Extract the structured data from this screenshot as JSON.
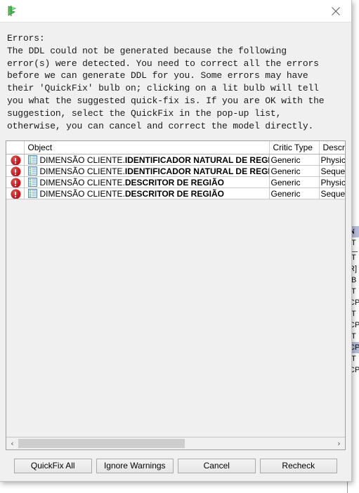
{
  "window": {
    "title": "",
    "app_icon": "green-flag-icon",
    "close_label": "✕"
  },
  "message": {
    "heading": "Errors:",
    "body": "The DDL could not be generated because the following\nerror(s) were detected. You need to correct all the errors\nbefore we can generate DDL for you. Some errors may have\ntheir 'QuickFix' bulb on; clicking on a lit bulb will tell\nyou what the suggested quick-fix is. If you are OK with the\nsuggestion, select the QuickFix in the pop-up list,\notherwise, you can cancel and correct the model directly."
  },
  "table": {
    "columns": [
      "",
      "Object",
      "Critic Type",
      "Descript"
    ],
    "rows": [
      {
        "severity_icon": "error-icon",
        "object_icon": "table-grid-icon",
        "object_prefix": "DIMENSÃO CLIENTE.",
        "object_name": "IDENTIFICADOR NATURAL DE REGIÃO",
        "critic_type": "Generic",
        "description": "Physical n"
      },
      {
        "severity_icon": "error-icon",
        "object_icon": "table-grid-icon",
        "object_prefix": "DIMENSÃO CLIENTE.",
        "object_name": "IDENTIFICADOR NATURAL DE REGIÃO",
        "critic_type": "Generic",
        "description": "Sequence"
      },
      {
        "severity_icon": "error-icon",
        "object_icon": "table-grid-icon",
        "object_prefix": "DIMENSÃO CLIENTE.",
        "object_name": "DESCRITOR DE REGIÃO",
        "critic_type": "Generic",
        "description": "Physical n"
      },
      {
        "severity_icon": "error-icon",
        "object_icon": "table-grid-icon",
        "object_prefix": "DIMENSÃO CLIENTE.",
        "object_name": "DESCRITOR DE REGIÃO",
        "critic_type": "Generic",
        "description": "Sequence"
      }
    ]
  },
  "scrollbar": {
    "left_arrow": "‹",
    "right_arrow": "›",
    "thumb_position_percent": 0,
    "thumb_width_percent": 53
  },
  "buttons": [
    {
      "label": "QuickFix All",
      "name": "quickfix-all-button"
    },
    {
      "label": "Ignore Warnings",
      "name": "ignore-warnings-button"
    },
    {
      "label": "Cancel",
      "name": "cancel-button"
    },
    {
      "label": "Recheck",
      "name": "recheck-button"
    }
  ],
  "background_panel": {
    "items": [
      {
        "text": "N",
        "selected": true,
        "bold": true
      },
      {
        "text": "IT",
        "selected": false,
        "bold": false
      },
      {
        "text": "",
        "selected": false,
        "bold": false,
        "separator": true
      },
      {
        "text": "IT",
        "selected": false,
        "bold": false
      },
      {
        "text": "R]",
        "selected": false,
        "bold": false
      },
      {
        "text": "[B",
        "selected": false,
        "bold": false
      },
      {
        "text": "IT",
        "selected": false,
        "bold": false
      },
      {
        "text": "CP",
        "selected": false,
        "bold": false
      },
      {
        "text": "IT",
        "selected": false,
        "bold": false
      },
      {
        "text": "CP",
        "selected": false,
        "bold": false
      },
      {
        "text": "IT",
        "selected": false,
        "bold": false
      },
      {
        "text": "CP",
        "selected": true,
        "bold": false
      },
      {
        "text": "IT",
        "selected": false,
        "bold": false
      },
      {
        "text": "CP",
        "selected": false,
        "bold": false
      }
    ]
  },
  "colors": {
    "dialog_bg": "#f0f0f0",
    "titlebar_bg": "#ffffff",
    "error_red": "#cf1720",
    "selection_blue": "#b6bedc",
    "scrollbar_thumb": "#cdcdcd"
  }
}
